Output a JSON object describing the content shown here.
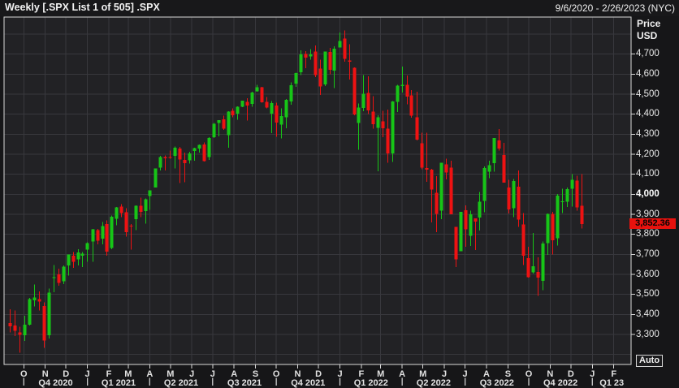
{
  "window": {
    "title": "Weekly [.SPX List 1 of 505] .SPX",
    "date_range": "9/6/2020 - 2/26/2023 (NYC)"
  },
  "y_axis": {
    "header_line1": "Price",
    "header_line2": "USD",
    "ticks": [
      {
        "label": "4,700",
        "value": 4700,
        "bold": false
      },
      {
        "label": "4,600",
        "value": 4600,
        "bold": false
      },
      {
        "label": "4,500",
        "value": 4500,
        "bold": false
      },
      {
        "label": "4,400",
        "value": 4400,
        "bold": false
      },
      {
        "label": "4,300",
        "value": 4300,
        "bold": false
      },
      {
        "label": "4,200",
        "value": 4200,
        "bold": false
      },
      {
        "label": "4,100",
        "value": 4100,
        "bold": false
      },
      {
        "label": "4,000",
        "value": 4000,
        "bold": true
      },
      {
        "label": "3,900",
        "value": 3900,
        "bold": false
      },
      {
        "label": "3,800",
        "value": 3800,
        "bold": false
      },
      {
        "label": "3,700",
        "value": 3700,
        "bold": false
      },
      {
        "label": "3,600",
        "value": 3600,
        "bold": false
      },
      {
        "label": "3,500",
        "value": 3500,
        "bold": false
      },
      {
        "label": "3,400",
        "value": 3400,
        "bold": false
      },
      {
        "label": "3,300",
        "value": 3300,
        "bold": false
      }
    ],
    "last_price": {
      "label": "3,852.36",
      "value": 3852.36
    }
  },
  "x_axis": {
    "range_start": "2020-09-06",
    "range_end": "2023-02-26",
    "months": [
      {
        "label": "O",
        "date": "2020-10-01"
      },
      {
        "label": "N",
        "date": "2020-11-01"
      },
      {
        "label": "D",
        "date": "2020-12-01"
      },
      {
        "label": "J",
        "date": "2021-01-01"
      },
      {
        "label": "F",
        "date": "2021-02-01"
      },
      {
        "label": "M",
        "date": "2021-03-01"
      },
      {
        "label": "A",
        "date": "2021-04-01"
      },
      {
        "label": "M",
        "date": "2021-05-01"
      },
      {
        "label": "J",
        "date": "2021-06-01"
      },
      {
        "label": "J",
        "date": "2021-07-01"
      },
      {
        "label": "A",
        "date": "2021-08-01"
      },
      {
        "label": "S",
        "date": "2021-09-01"
      },
      {
        "label": "O",
        "date": "2021-10-01"
      },
      {
        "label": "N",
        "date": "2021-11-01"
      },
      {
        "label": "D",
        "date": "2021-12-01"
      },
      {
        "label": "J",
        "date": "2022-01-01"
      },
      {
        "label": "F",
        "date": "2022-02-01"
      },
      {
        "label": "M",
        "date": "2022-03-01"
      },
      {
        "label": "A",
        "date": "2022-04-01"
      },
      {
        "label": "M",
        "date": "2022-05-01"
      },
      {
        "label": "J",
        "date": "2022-06-01"
      },
      {
        "label": "J",
        "date": "2022-07-01"
      },
      {
        "label": "A",
        "date": "2022-08-01"
      },
      {
        "label": "S",
        "date": "2022-09-01"
      },
      {
        "label": "O",
        "date": "2022-10-01"
      },
      {
        "label": "N",
        "date": "2022-11-01"
      },
      {
        "label": "D",
        "date": "2022-12-01"
      },
      {
        "label": "J",
        "date": "2023-01-01"
      },
      {
        "label": "F",
        "date": "2023-02-01"
      }
    ],
    "quarters": [
      {
        "label": "Q4 2020",
        "start": "2020-10-01",
        "end": "2021-01-01"
      },
      {
        "label": "Q1 2021",
        "start": "2021-01-01",
        "end": "2021-04-01"
      },
      {
        "label": "Q2 2021",
        "start": "2021-04-01",
        "end": "2021-07-01"
      },
      {
        "label": "Q3 2021",
        "start": "2021-07-01",
        "end": "2021-10-01"
      },
      {
        "label": "Q4 2021",
        "start": "2021-10-01",
        "end": "2022-01-01"
      },
      {
        "label": "Q1 2022",
        "start": "2022-01-01",
        "end": "2022-04-01"
      },
      {
        "label": "Q2 2022",
        "start": "2022-04-01",
        "end": "2022-07-01"
      },
      {
        "label": "Q3 2022",
        "start": "2022-07-01",
        "end": "2022-10-01"
      },
      {
        "label": "Q4 2022",
        "start": "2022-10-01",
        "end": "2023-01-01"
      },
      {
        "label": "Q1 23",
        "start": "2023-01-01",
        "end": "2023-02-26"
      }
    ]
  },
  "auto_button": {
    "label": "Auto"
  },
  "colors": {
    "up": "#17c517",
    "down": "#ee1212",
    "last_price_bg": "#e8120e",
    "grid": "#38383d",
    "frame": "#d9d9d9",
    "plot_bg": "#222225"
  },
  "chart_data": {
    "type": "candlestick",
    "title": "Weekly [.SPX List 1 of 505] .SPX",
    "symbol": ".SPX",
    "interval": "Weekly",
    "currency": "USD",
    "ylim": [
      3150,
      4885
    ],
    "grid": true,
    "candles": [
      [
        "2020-09-11",
        3356,
        3425,
        3310,
        3341
      ],
      [
        "2020-09-18",
        3344,
        3419,
        3292,
        3319
      ],
      [
        "2020-09-25",
        3310,
        3338,
        3209,
        3298
      ],
      [
        "2020-10-02",
        3297,
        3393,
        3268,
        3348
      ],
      [
        "2020-10-09",
        3349,
        3483,
        3344,
        3477
      ],
      [
        "2020-10-16",
        3470,
        3550,
        3440,
        3484
      ],
      [
        "2020-10-23",
        3477,
        3515,
        3419,
        3465
      ],
      [
        "2020-10-30",
        3441,
        3461,
        3233,
        3270
      ],
      [
        "2020-11-06",
        3296,
        3529,
        3279,
        3509
      ],
      [
        "2020-11-13",
        3583,
        3646,
        3511,
        3585
      ],
      [
        "2020-11-20",
        3600,
        3628,
        3543,
        3558
      ],
      [
        "2020-11-27",
        3566,
        3644,
        3552,
        3638
      ],
      [
        "2020-12-04",
        3645,
        3699,
        3594,
        3699
      ],
      [
        "2020-12-11",
        3694,
        3712,
        3633,
        3663
      ],
      [
        "2020-12-18",
        3675,
        3726,
        3645,
        3709
      ],
      [
        "2020-12-24",
        3694,
        3711,
        3636,
        3703
      ],
      [
        "2020-12-31",
        3723,
        3760,
        3662,
        3756
      ],
      [
        "2021-01-08",
        3764,
        3826,
        3663,
        3825
      ],
      [
        "2021-01-15",
        3820,
        3827,
        3749,
        3768
      ],
      [
        "2021-01-22",
        3778,
        3861,
        3750,
        3841
      ],
      [
        "2021-01-29",
        3851,
        3870,
        3694,
        3714
      ],
      [
        "2021-02-05",
        3732,
        3894,
        3725,
        3887
      ],
      [
        "2021-02-12",
        3878,
        3937,
        3845,
        3935
      ],
      [
        "2021-02-19",
        3939,
        3950,
        3885,
        3907
      ],
      [
        "2021-02-26",
        3910,
        3930,
        3789,
        3811
      ],
      [
        "2021-03-05",
        3843,
        3851,
        3723,
        3842
      ],
      [
        "2021-03-12",
        3876,
        3944,
        3821,
        3943
      ],
      [
        "2021-03-19",
        3942,
        3984,
        3886,
        3913
      ],
      [
        "2021-03-26",
        3917,
        3978,
        3854,
        3975
      ],
      [
        "2021-04-01",
        3992,
        4020,
        3923,
        4020
      ],
      [
        "2021-04-09",
        4034,
        4129,
        4034,
        4129
      ],
      [
        "2021-04-16",
        4134,
        4191,
        4118,
        4185
      ],
      [
        "2021-04-23",
        4185,
        4194,
        4119,
        4180
      ],
      [
        "2021-04-30",
        4185,
        4218,
        4177,
        4181
      ],
      [
        "2021-05-07",
        4191,
        4238,
        4129,
        4233
      ],
      [
        "2021-05-14",
        4228,
        4236,
        4057,
        4174
      ],
      [
        "2021-05-21",
        4171,
        4209,
        4061,
        4156
      ],
      [
        "2021-05-28",
        4170,
        4213,
        4153,
        4204
      ],
      [
        "2021-06-04",
        4217,
        4233,
        4168,
        4230
      ],
      [
        "2021-06-11",
        4229,
        4249,
        4208,
        4247
      ],
      [
        "2021-06-18",
        4248,
        4258,
        4164,
        4166
      ],
      [
        "2021-06-25",
        4185,
        4286,
        4171,
        4281
      ],
      [
        "2021-07-02",
        4285,
        4355,
        4281,
        4352
      ],
      [
        "2021-07-09",
        4356,
        4371,
        4289,
        4370
      ],
      [
        "2021-07-16",
        4374,
        4393,
        4322,
        4327
      ],
      [
        "2021-07-23",
        4296,
        4415,
        4233,
        4412
      ],
      [
        "2021-07-30",
        4417,
        4429,
        4384,
        4395
      ],
      [
        "2021-08-06",
        4402,
        4440,
        4373,
        4437
      ],
      [
        "2021-08-13",
        4437,
        4468,
        4436,
        4468
      ],
      [
        "2021-08-20",
        4462,
        4480,
        4368,
        4442
      ],
      [
        "2021-08-27",
        4451,
        4513,
        4437,
        4509
      ],
      [
        "2021-09-03",
        4513,
        4546,
        4513,
        4535
      ],
      [
        "2021-09-10",
        4535,
        4536,
        4458,
        4459
      ],
      [
        "2021-09-17",
        4462,
        4486,
        4428,
        4433
      ],
      [
        "2021-09-24",
        4403,
        4465,
        4306,
        4455
      ],
      [
        "2021-10-01",
        4443,
        4457,
        4288,
        4357
      ],
      [
        "2021-10-08",
        4348,
        4429,
        4278,
        4391
      ],
      [
        "2021-10-15",
        4385,
        4475,
        4329,
        4471
      ],
      [
        "2021-10-22",
        4463,
        4559,
        4447,
        4545
      ],
      [
        "2021-10-29",
        4553,
        4608,
        4537,
        4605
      ],
      [
        "2021-11-05",
        4610,
        4718,
        4595,
        4698
      ],
      [
        "2021-11-12",
        4701,
        4714,
        4630,
        4683
      ],
      [
        "2021-11-19",
        4689,
        4724,
        4672,
        4698
      ],
      [
        "2021-11-26",
        4712,
        4744,
        4585,
        4595
      ],
      [
        "2021-12-03",
        4628,
        4672,
        4495,
        4538
      ],
      [
        "2021-12-10",
        4548,
        4713,
        4540,
        4712
      ],
      [
        "2021-12-17",
        4710,
        4731,
        4600,
        4621
      ],
      [
        "2021-12-23",
        4618,
        4740,
        4531,
        4726
      ],
      [
        "2021-12-31",
        4734,
        4808,
        4733,
        4766
      ],
      [
        "2022-01-07",
        4778,
        4819,
        4662,
        4677
      ],
      [
        "2022-01-14",
        4669,
        4749,
        4573,
        4663
      ],
      [
        "2022-01-21",
        4632,
        4633,
        4395,
        4398
      ],
      [
        "2022-01-28",
        4356,
        4453,
        4223,
        4432
      ],
      [
        "2022-02-04",
        4431,
        4595,
        4414,
        4501
      ],
      [
        "2022-02-11",
        4505,
        4590,
        4401,
        4419
      ],
      [
        "2022-02-18",
        4413,
        4489,
        4328,
        4349
      ],
      [
        "2022-02-25",
        4332,
        4394,
        4115,
        4385
      ],
      [
        "2022-03-04",
        4364,
        4417,
        4285,
        4329
      ],
      [
        "2022-03-11",
        4327,
        4423,
        4158,
        4204
      ],
      [
        "2022-03-18",
        4203,
        4465,
        4162,
        4463
      ],
      [
        "2022-03-25",
        4462,
        4546,
        4411,
        4543
      ],
      [
        "2022-04-01",
        4541,
        4637,
        4507,
        4546
      ],
      [
        "2022-04-08",
        4547,
        4593,
        4450,
        4488
      ],
      [
        "2022-04-14",
        4494,
        4520,
        4382,
        4393
      ],
      [
        "2022-04-22",
        4385,
        4512,
        4268,
        4272
      ],
      [
        "2022-04-29",
        4255,
        4308,
        4124,
        4132
      ],
      [
        "2022-05-06",
        4130,
        4307,
        4062,
        4123
      ],
      [
        "2022-05-13",
        4122,
        4126,
        3859,
        4024
      ],
      [
        "2022-05-20",
        4008,
        4090,
        3810,
        3901
      ],
      [
        "2022-05-27",
        3919,
        4158,
        3875,
        4158
      ],
      [
        "2022-06-03",
        4149,
        4177,
        4074,
        4109
      ],
      [
        "2022-06-10",
        4134,
        4168,
        3900,
        3901
      ],
      [
        "2022-06-17",
        3838,
        3838,
        3637,
        3675
      ],
      [
        "2022-06-24",
        3715,
        3913,
        3715,
        3912
      ],
      [
        "2022-07-01",
        3920,
        3945,
        3738,
        3825
      ],
      [
        "2022-07-08",
        3792,
        3918,
        3742,
        3899
      ],
      [
        "2022-07-15",
        3880,
        3880,
        3721,
        3863
      ],
      [
        "2022-07-22",
        3883,
        4012,
        3818,
        3962
      ],
      [
        "2022-07-29",
        3966,
        4140,
        3910,
        4130
      ],
      [
        "2022-08-05",
        4112,
        4167,
        4080,
        4145
      ],
      [
        "2022-08-12",
        4155,
        4280,
        4112,
        4280
      ],
      [
        "2022-08-19",
        4269,
        4325,
        4219,
        4228
      ],
      [
        "2022-08-26",
        4195,
        4257,
        4058,
        4058
      ],
      [
        "2022-09-02",
        4034,
        4073,
        3904,
        3924
      ],
      [
        "2022-09-09",
        3930,
        4076,
        3886,
        4067
      ],
      [
        "2022-09-16",
        4037,
        4119,
        3837,
        3873
      ],
      [
        "2022-09-23",
        3850,
        3907,
        3647,
        3693
      ],
      [
        "2022-09-30",
        3682,
        3737,
        3584,
        3586
      ],
      [
        "2022-10-07",
        3609,
        3807,
        3604,
        3640
      ],
      [
        "2022-10-14",
        3612,
        3685,
        3492,
        3583
      ],
      [
        "2022-10-21",
        3567,
        3765,
        3521,
        3753
      ],
      [
        "2022-10-28",
        3755,
        3905,
        3698,
        3901
      ],
      [
        "2022-11-04",
        3901,
        3912,
        3700,
        3771
      ],
      [
        "2022-11-11",
        3780,
        4001,
        3744,
        3993
      ],
      [
        "2022-11-18",
        3964,
        4028,
        3906,
        3965
      ],
      [
        "2022-11-25",
        3962,
        4034,
        3937,
        4026
      ],
      [
        "2022-12-02",
        4027,
        4101,
        3938,
        4072
      ],
      [
        "2022-12-09",
        4069,
        4092,
        3918,
        3934
      ],
      [
        "2022-12-16",
        3943,
        4101,
        3828,
        3852.36
      ]
    ]
  }
}
